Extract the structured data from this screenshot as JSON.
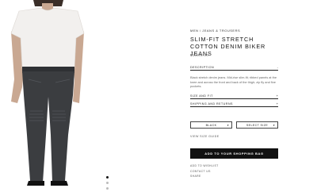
{
  "product": {
    "breadcrumb": "MEN / JEANS & TROUSERS",
    "title": "SLIM-FIT STRETCH COTTON DENIM BIKER JEANS",
    "price": "$1,395.00"
  },
  "accordion": {
    "description_label": "DESCRIPTION",
    "description_text": "Black stretch denim jeans. Mid-rise slim-fit; ribbed panels at the knee and across the front and back of the thigh; zip fly and five pockets.",
    "size_fit_label": "SIZE AND FIT",
    "shipping_label": "SHIPPING AND RETURNS",
    "toggle_collapsed": "+",
    "toggle_expanded": "-"
  },
  "options": {
    "color_value": "BLACK",
    "size_placeholder": "SELECT SIZE",
    "chevron": "▾",
    "size_guide_label": "VIEW SIZE GUIDE"
  },
  "cta": {
    "add_to_bag_label": "ADD TO YOUR SHOPPING BAG"
  },
  "links": {
    "wishlist": "ADD TO WISHLIST",
    "contact": "CONTACT US",
    "share": "SHARE"
  },
  "gallery": {
    "slide_count": 3,
    "active_slide": 1
  },
  "colors": {
    "accent": "#111111",
    "denim": "#3b3d40",
    "shirt": "#f2f0ee",
    "skin": "#c9a892"
  }
}
